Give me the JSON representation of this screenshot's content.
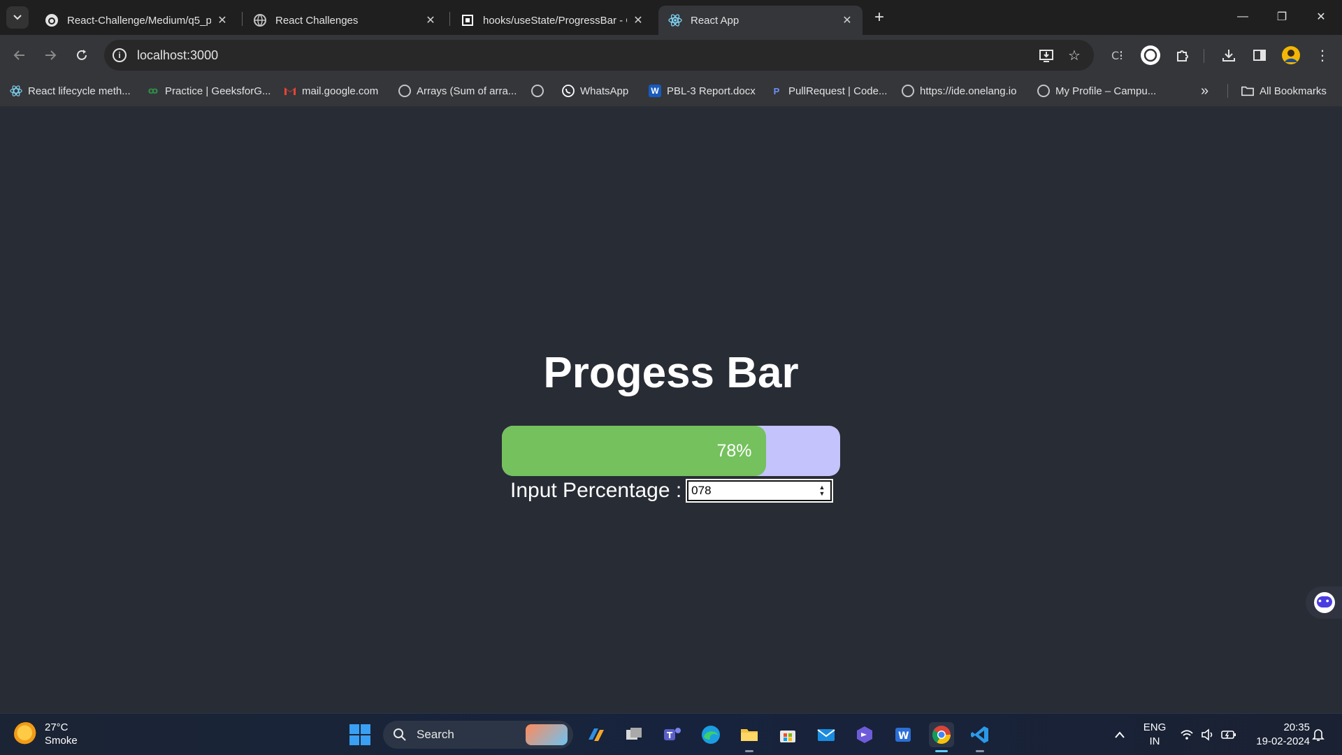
{
  "browser": {
    "tabs": [
      {
        "title": "React-Challenge/Medium/q5_p",
        "favicon": "github-icon",
        "active": false
      },
      {
        "title": "React Challenges",
        "favicon": "globe-icon",
        "active": false
      },
      {
        "title": "hooks/useState/ProgressBar - C",
        "favicon": "codesandbox-icon",
        "active": false
      },
      {
        "title": "React App",
        "favicon": "react-icon",
        "active": true
      }
    ],
    "new_tab": "+",
    "window_controls": {
      "minimize": "—",
      "restore": "❐",
      "close": "✕"
    },
    "url": "localhost:3000",
    "bookmarks": [
      {
        "label": "React lifecycle meth...",
        "icon": "react-icon"
      },
      {
        "label": "Practice | GeeksforG...",
        "icon": "geeksforgeeks-icon"
      },
      {
        "label": "mail.google.com",
        "icon": "gmail-icon"
      },
      {
        "label": "Arrays (Sum of arra...",
        "icon": "globe-icon"
      },
      {
        "label": "",
        "icon": "globe-icon"
      },
      {
        "label": "WhatsApp",
        "icon": "whatsapp-icon"
      },
      {
        "label": "PBL-3 Report.docx",
        "icon": "word-icon"
      },
      {
        "label": "PullRequest | Code...",
        "icon": "pullrequest-icon"
      },
      {
        "label": "https://ide.onelang.io",
        "icon": "globe-icon"
      },
      {
        "label": "My Profile – Campu...",
        "icon": "globe-icon"
      }
    ],
    "bookmarks_overflow": "»",
    "all_bookmarks": "All Bookmarks"
  },
  "app": {
    "heading": "Progess Bar",
    "progress": {
      "percent": 78,
      "label": "78%",
      "fill_color": "#74c15d",
      "track_color": "#c4c3fb"
    },
    "input_label": "Input Percentage :",
    "input_value": "078"
  },
  "taskbar": {
    "weather": {
      "temp": "27°C",
      "condition": "Smoke"
    },
    "search_label": "Search",
    "language": {
      "line1": "ENG",
      "line2": "IN"
    },
    "clock": {
      "time": "20:35",
      "date": "19-02-2024"
    }
  }
}
